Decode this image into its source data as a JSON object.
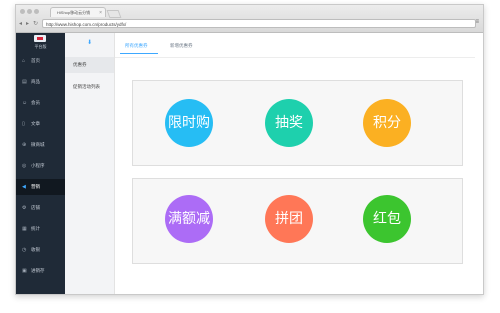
{
  "browser": {
    "tab_title": "HiShop移动云分销",
    "url": "http://www.hishop.com.cn/products/ydfx/"
  },
  "sidebar": {
    "brand": "平台版",
    "items": [
      {
        "label": "首页",
        "icon": "home-icon",
        "glyph": "⌂"
      },
      {
        "label": "商品",
        "icon": "box-icon",
        "glyph": "▤"
      },
      {
        "label": "会员",
        "icon": "user-icon",
        "glyph": "☺"
      },
      {
        "label": "文章",
        "icon": "document-icon",
        "glyph": "▯"
      },
      {
        "label": "微商城",
        "icon": "shop-icon",
        "glyph": "⊕"
      },
      {
        "label": "小程序",
        "icon": "miniapp-icon",
        "glyph": "◎"
      },
      {
        "label": "营销",
        "icon": "megaphone-icon",
        "glyph": "◀",
        "active": true
      },
      {
        "label": "店铺",
        "icon": "store-icon",
        "glyph": "⚙"
      },
      {
        "label": "统计",
        "icon": "chart-icon",
        "glyph": "▦"
      },
      {
        "label": "收银",
        "icon": "cashier-icon",
        "glyph": "◷"
      },
      {
        "label": "进销存",
        "icon": "inventory-icon",
        "glyph": "▣"
      }
    ]
  },
  "subsidebar": {
    "items": [
      {
        "label": "优惠券",
        "active": true
      },
      {
        "label": "促销活动列表",
        "active": false
      }
    ]
  },
  "main": {
    "tabs": [
      {
        "label": "所有优惠券",
        "active": true
      },
      {
        "label": "新增优惠券",
        "active": false
      }
    ]
  },
  "promotions": [
    {
      "label": "限时购",
      "color": "#26bdf4"
    },
    {
      "label": "抽奖",
      "color": "#1ed0ad"
    },
    {
      "label": "积分",
      "color": "#fbb022"
    },
    {
      "label": "满额减",
      "color": "#ac6cf6"
    },
    {
      "label": "拼团",
      "color": "#ff7757"
    },
    {
      "label": "红包",
      "color": "#3cc52f"
    }
  ],
  "colors": {
    "sidebar_bg": "#1f2a37",
    "accent": "#3ea8ff"
  }
}
